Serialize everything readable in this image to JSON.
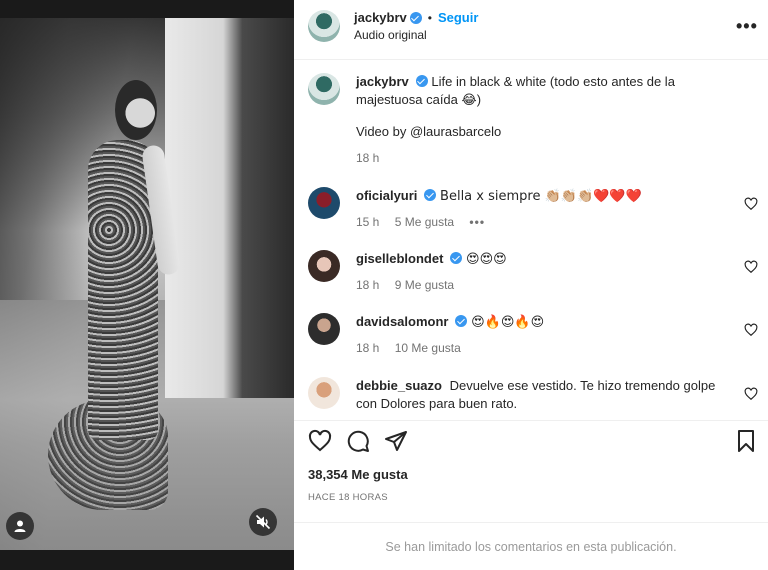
{
  "post": {
    "username": "jackybrv",
    "follow_label": "Seguir",
    "audio": "Audio original",
    "dot": "•",
    "more": "•••"
  },
  "caption": {
    "username": "jackybrv",
    "text": "Life in black & white (todo esto antes de la majestuosa caída 😂)",
    "credit": "Video by @laurasbarcelo",
    "time": "18 h"
  },
  "comments": [
    {
      "username": "oficialyuri",
      "verified": true,
      "text": "Bella x siempre 👏🏼👏🏼👏🏼❤️❤️❤️",
      "time": "15 h",
      "likes": "5 Me gusta",
      "more": "•••"
    },
    {
      "username": "giselleblondet",
      "verified": true,
      "text": "😍😍😍",
      "time": "18 h",
      "likes": "9 Me gusta"
    },
    {
      "username": "davidsalomonr",
      "verified": true,
      "text": "😍🔥😍🔥😍",
      "time": "18 h",
      "likes": "10 Me gusta"
    },
    {
      "username": "debbie_suazo",
      "verified": false,
      "text": "Devuelve ese vestido. Te hizo tremendo golpe con Dolores para buen rato."
    }
  ],
  "stats": {
    "likes": "38,354 Me gusta",
    "time_ago": "HACE 18 HORAS"
  },
  "footer": {
    "limited": "Se han limitado los comentarios en esta publicación."
  },
  "icons": {
    "like": "heart-icon",
    "comment": "comment-icon",
    "share": "share-icon",
    "save": "bookmark-icon",
    "mute": "speaker-muted-icon",
    "user": "user-icon"
  },
  "colors": {
    "accent": "#0095f6",
    "verified": "#3897f0",
    "muted_text": "#737373"
  }
}
